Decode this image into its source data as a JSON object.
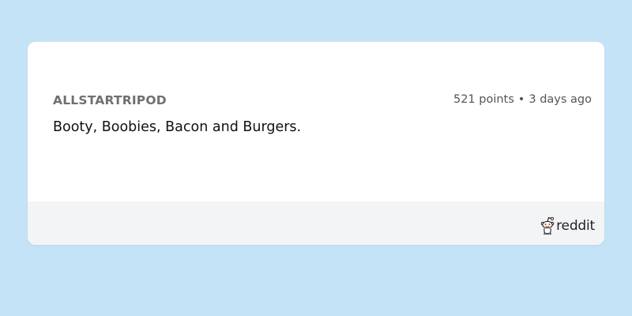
{
  "comment": {
    "author": "ALLSTARTRIPOD",
    "points": "521 points",
    "separator": "•",
    "age": "3 days ago",
    "body": "Booty, Boobies, Bacon and Burgers."
  },
  "footer": {
    "brand_icon": "reddit-alien-icon",
    "brand_name": "reddit"
  },
  "colors": {
    "background": "#c5e3f7",
    "card": "#ffffff",
    "footer": "#f3f4f6",
    "author": "#707070",
    "brand_accent": "#ff4500"
  }
}
